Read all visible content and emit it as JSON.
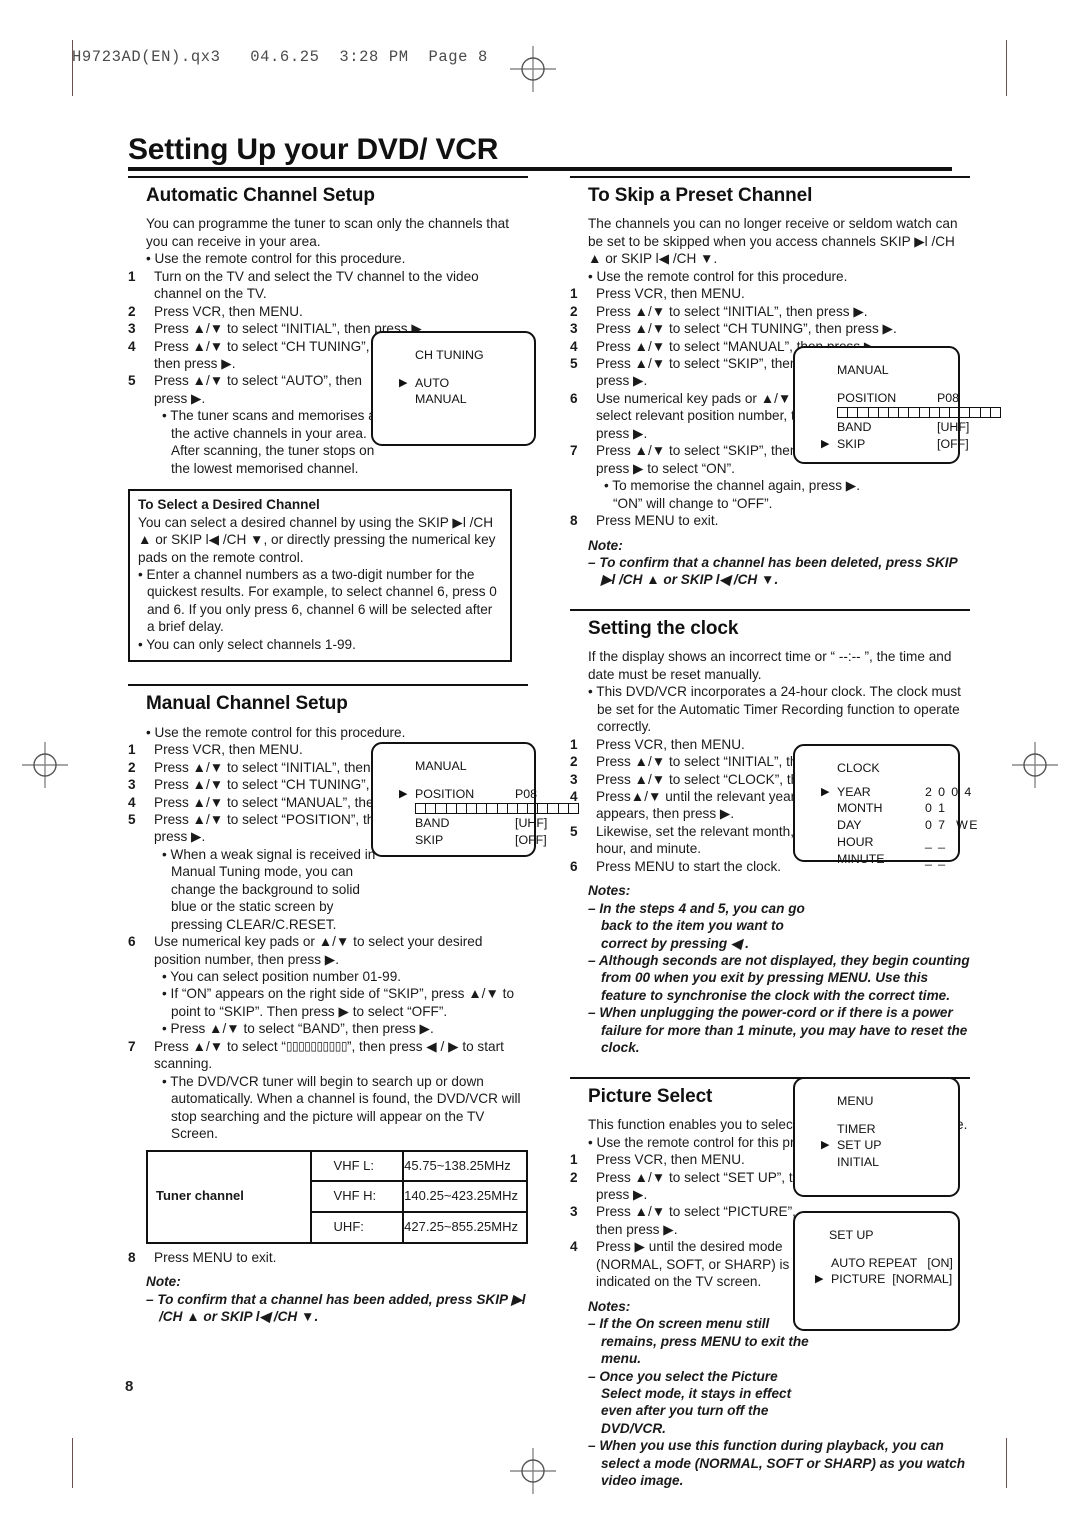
{
  "page": {
    "slug": "H9723AD(EN).qx3   04.6.25  3:28 PM  Page 8",
    "folio": "8",
    "title": "Setting Up your DVD/ VCR"
  },
  "left_column": {
    "automatic_channel_setup": {
      "heading": "Automatic Channel Setup",
      "intro": "You can programme the tuner to scan only the channels that you can receive in your area.",
      "intro_bullet": "• Use the remote control for this procedure.",
      "steps": [
        {
          "num": "1",
          "text": "Turn on the TV and select the TV channel to the video channel on the TV."
        },
        {
          "num": "2",
          "text": "Press VCR, then MENU."
        },
        {
          "num": "3",
          "text": "Press ▲/▼ to select “INITIAL”, then press ▶."
        },
        {
          "num": "4",
          "text": "Press ▲/▼ to select “CH TUNING”, then press ▶."
        },
        {
          "num": "5",
          "text": "Press ▲/▼ to select “AUTO”, then press ▶."
        }
      ],
      "step5_sub": "• The tuner scans and memorises all the active channels in your area.  After scanning, the tuner stops on the lowest memorised channel.",
      "osd": {
        "title": "CH TUNING",
        "rows": [
          {
            "cursor": "▶",
            "label": "AUTO"
          },
          {
            "cursor": "",
            "label": "MANUAL"
          }
        ]
      }
    },
    "desired_channel_box": {
      "heading": "To Select a Desired Channel",
      "body": "You can select a desired channel by using the SKIP ▶l /CH ▲ or SKIP l◀ /CH ▼, or directly pressing the numerical key pads on the remote control.",
      "bullets": [
        "• Enter a channel numbers as a two-digit number for the quickest results. For example, to select channel 6, press 0 and 6. If you only press 6, channel 6 will be selected after a brief delay.",
        "• You can only select channels 1-99."
      ]
    },
    "manual_channel_setup": {
      "heading": "Manual Channel Setup",
      "intro_bullet": "• Use the remote control for this procedure.",
      "steps": [
        {
          "num": "1",
          "text": "Press VCR, then MENU."
        },
        {
          "num": "2",
          "text": "Press ▲/▼ to select “INITIAL”, then press ▶."
        },
        {
          "num": "3",
          "text": "Press ▲/▼ to select “CH TUNING”, then press ▶."
        },
        {
          "num": "4",
          "text": "Press ▲/▼ to select “MANUAL”, then press ▶."
        },
        {
          "num": "5",
          "text": "Press ▲/▼ to select “POSITION”, then press ▶."
        }
      ],
      "step5_sub": "• When a weak signal is received in Manual Tuning mode, you can change the background to solid blue or the static screen by pressing CLEAR/C.RESET.",
      "step6": {
        "num": "6",
        "text": "Use numerical key pads or ▲/▼ to select your desired position number, then press ▶."
      },
      "step6_subs": [
        "• You can select position number 01-99.",
        "• If “ON” appears on the right side of “SKIP”, press ▲/▼ to point to “SKIP”.  Then press ▶ to select “OFF”.",
        "• Press ▲/▼ to select “BAND”, then press ▶."
      ],
      "step7_pre": "Press ▲/▼ to select “",
      "step7_post": "”, then press ◀ / ▶ to start scanning.",
      "step7_sub": "• The DVD/VCR tuner will begin to search up or down automatically. When a channel is found, the DVD/VCR will stop searching and the picture will appear on the TV Screen.",
      "step8": {
        "num": "8",
        "text": "Press MENU to exit."
      },
      "note_head": "Note:",
      "note_items": [
        "– To confirm that a channel has been added, press SKIP ▶l /CH ▲ or SKIP l◀ /CH ▼."
      ],
      "osd": {
        "title": "MANUAL",
        "rows": [
          {
            "cursor": "▶",
            "label": "POSITION",
            "value": "P08"
          },
          {
            "cursor": "",
            "label": "BAND",
            "value": "[UHF]"
          },
          {
            "cursor": "",
            "label": "SKIP",
            "value": "[OFF]"
          }
        ]
      },
      "freq_table": {
        "label": "Tuner channel",
        "rows": [
          {
            "band": "VHF L:",
            "range": "45.75~138.25MHz"
          },
          {
            "band": "VHF H:",
            "range": "140.25~423.25MHz"
          },
          {
            "band": "UHF:",
            "range": "427.25~855.25MHz"
          }
        ]
      }
    }
  },
  "right_column": {
    "skip_preset_channel": {
      "heading": "To Skip a Preset Channel",
      "intro": "The channels you can no longer receive or seldom watch can be set to be skipped when you access channels SKIP ▶l /CH ▲ or SKIP l◀ /CH ▼.",
      "intro_bullet": "• Use the remote control for this procedure.",
      "steps": [
        {
          "num": "1",
          "text": "Press VCR, then MENU."
        },
        {
          "num": "2",
          "text": "Press ▲/▼ to select “INITIAL”, then press ▶."
        },
        {
          "num": "3",
          "text": "Press ▲/▼ to select “CH TUNING”, then press ▶."
        },
        {
          "num": "4",
          "text": "Press ▲/▼ to select “MANUAL”, then press ▶."
        },
        {
          "num": "5",
          "text": "Press ▲/▼ to select “SKIP”, then press ▶."
        },
        {
          "num": "6",
          "text": "Use numerical key pads or ▲/▼ to select relevant position number, then press ▶."
        },
        {
          "num": "7",
          "text": "Press ▲/▼ to select “SKIP”, then press ▶ to select “ON”."
        }
      ],
      "step7_sub": "• To memorise the channel again, press ▶. “ON” will change to “OFF”.",
      "step8": {
        "num": "8",
        "text": "Press MENU to exit."
      },
      "note_head": "Note:",
      "note_items": [
        "– To confirm that a channel has been deleted, press SKIP ▶l /CH ▲ or SKIP l◀ /CH ▼."
      ],
      "osd": {
        "title": "MANUAL",
        "rows": [
          {
            "cursor": "",
            "label": "POSITION",
            "value": "P08"
          },
          {
            "cursor": "",
            "label": "BAND",
            "value": "[UHF]"
          },
          {
            "cursor": "▶",
            "label": "SKIP",
            "value": "[OFF]"
          }
        ]
      }
    },
    "setting_the_clock": {
      "heading": "Setting the clock",
      "intro": "If the display shows an incorrect time or “ --:-- ”, the time and date must be reset manually.",
      "intro_bullet": "• This DVD/VCR incorporates a 24-hour clock. The clock must be set for the Automatic Timer Recording function to operate correctly.",
      "steps": [
        {
          "num": "1",
          "text": "Press VCR, then MENU."
        },
        {
          "num": "2",
          "text": "Press ▲/▼ to select “INITIAL”, then press ▶."
        },
        {
          "num": "3",
          "text": "Press ▲/▼ to select “CLOCK”, then press ▶."
        },
        {
          "num": "4",
          "text": "Press▲/▼ until the relevant year appears, then press ▶."
        },
        {
          "num": "5",
          "text": "Likewise, set the relevant month, day, hour, and minute."
        },
        {
          "num": "6",
          "text": "Press MENU to start the clock."
        }
      ],
      "note_head": "Notes:",
      "note_items": [
        "– In the steps 4 and 5, you can go back to the item you want to correct by pressing ◀ .",
        "– Although seconds are not displayed, they begin counting from 00 when you exit by pressing MENU. Use this feature to synchronise the clock with the correct time.",
        "– When unplugging the power-cord or if there is a power failure for more than 1 minute, you may have to reset the clock."
      ],
      "osd": {
        "title": "CLOCK",
        "rows": [
          {
            "cursor": "▶",
            "label": "YEAR",
            "value": "2 0 0 4"
          },
          {
            "cursor": "",
            "label": "MONTH",
            "value": "0 1"
          },
          {
            "cursor": "",
            "label": "DAY",
            "value": "0 7  WE"
          },
          {
            "cursor": "",
            "label": "HOUR",
            "value": "_ _"
          },
          {
            "cursor": "",
            "label": "MINUTE",
            "value": "_ _"
          }
        ]
      }
    },
    "picture_select": {
      "heading": "Picture Select",
      "intro": "This function enables you to select the picture quality of a tape.",
      "intro_bullet": "• Use the remote control for this procedure.",
      "steps": [
        {
          "num": "1",
          "text": "Press VCR, then MENU."
        },
        {
          "num": "2",
          "text": "Press ▲/▼ to select “SET UP”, then press ▶."
        },
        {
          "num": "3",
          "text": "Press ▲/▼ to select “PICTURE”, then press ▶."
        },
        {
          "num": "4",
          "text": "Press ▶ until the desired mode (NORMAL, SOFT, or SHARP) is indicated on the TV screen."
        }
      ],
      "note_head": "Notes:",
      "note_items": [
        "– If the On screen menu still remains, press MENU to exit the menu.",
        "– Once you select the Picture Select mode, it stays in effect even after you turn off the DVD/VCR.",
        "– When you use this function during playback, you can select a mode (NORMAL, SOFT or SHARP) as you watch video image."
      ],
      "osd_menu": {
        "title": "MENU",
        "rows": [
          {
            "cursor": "",
            "label": "TIMER"
          },
          {
            "cursor": "▶",
            "label": "SET UP"
          },
          {
            "cursor": "",
            "label": "INITIAL"
          }
        ]
      },
      "osd_setup": {
        "title": "SET UP",
        "rows": [
          {
            "cursor": "",
            "label": "AUTO REPEAT   [ON]"
          },
          {
            "cursor": "▶",
            "label": "PICTURE  [NORMAL]"
          }
        ]
      }
    }
  }
}
